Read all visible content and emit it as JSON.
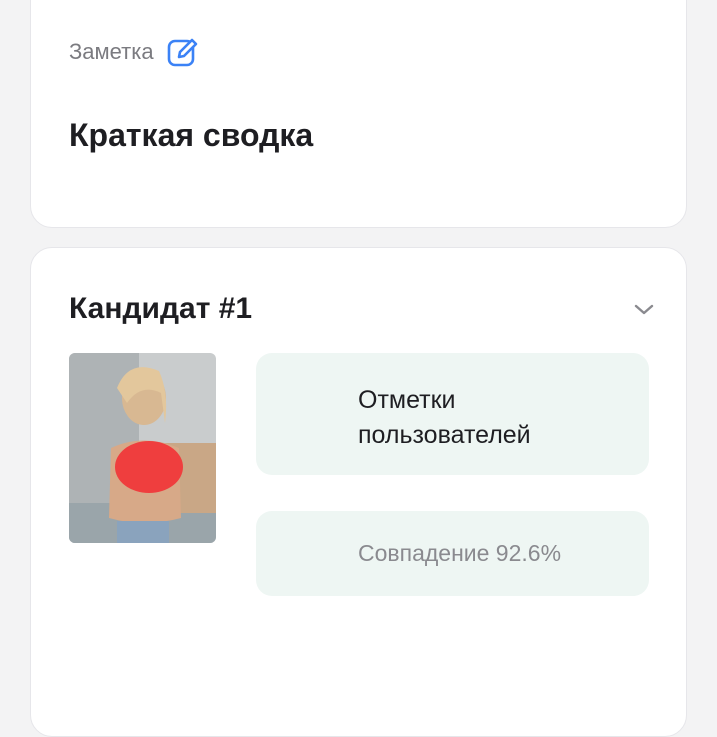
{
  "note": {
    "label": "Заметка",
    "edit_icon": "edit-icon",
    "summary_title": "Краткая сводка"
  },
  "candidate": {
    "title": "Кандидат #1",
    "chevron_icon": "chevron-down-icon",
    "user_marks_label": "Отметки пользователей",
    "match_label": "Совпадение 92.6%"
  },
  "colors": {
    "accent": "#3b82f6",
    "tile_bg": "#eef6f3",
    "card_bg": "#ffffff",
    "page_bg": "#f3f3f4"
  }
}
